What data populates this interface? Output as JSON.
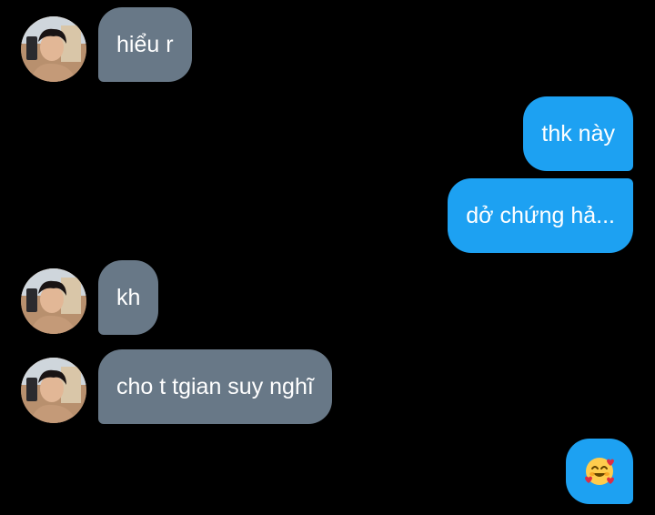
{
  "messages": [
    {
      "id": "m1",
      "direction": "in",
      "text": "hiểu r"
    },
    {
      "id": "m2",
      "direction": "out",
      "text": "thk này"
    },
    {
      "id": "m3",
      "direction": "out",
      "text": "dở chứng hả..."
    },
    {
      "id": "m4",
      "direction": "in",
      "text": "kh"
    },
    {
      "id": "m5",
      "direction": "in",
      "text": "cho t tgian suy nghĩ"
    },
    {
      "id": "m6",
      "direction": "out",
      "emoji": "smiling-face-with-hearts"
    }
  ],
  "colors": {
    "background": "#000000",
    "incoming_bubble": "#687887",
    "outgoing_bubble": "#1da1f2",
    "text": "#ffffff"
  },
  "icons": {
    "avatar": "contact-avatar-photo",
    "reaction": "smiling-face-with-hearts-emoji"
  }
}
